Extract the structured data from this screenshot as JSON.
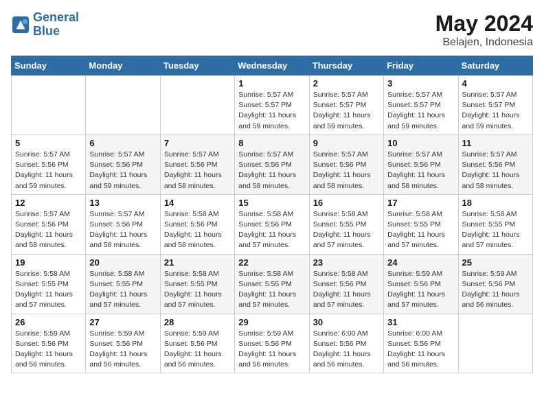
{
  "header": {
    "logo_line1": "General",
    "logo_line2": "Blue",
    "month": "May 2024",
    "location": "Belajen, Indonesia"
  },
  "weekdays": [
    "Sunday",
    "Monday",
    "Tuesday",
    "Wednesday",
    "Thursday",
    "Friday",
    "Saturday"
  ],
  "weeks": [
    [
      {
        "day": "",
        "info": ""
      },
      {
        "day": "",
        "info": ""
      },
      {
        "day": "",
        "info": ""
      },
      {
        "day": "1",
        "info": "Sunrise: 5:57 AM\nSunset: 5:57 PM\nDaylight: 11 hours\nand 59 minutes."
      },
      {
        "day": "2",
        "info": "Sunrise: 5:57 AM\nSunset: 5:57 PM\nDaylight: 11 hours\nand 59 minutes."
      },
      {
        "day": "3",
        "info": "Sunrise: 5:57 AM\nSunset: 5:57 PM\nDaylight: 11 hours\nand 59 minutes."
      },
      {
        "day": "4",
        "info": "Sunrise: 5:57 AM\nSunset: 5:57 PM\nDaylight: 11 hours\nand 59 minutes."
      }
    ],
    [
      {
        "day": "5",
        "info": "Sunrise: 5:57 AM\nSunset: 5:56 PM\nDaylight: 11 hours\nand 59 minutes."
      },
      {
        "day": "6",
        "info": "Sunrise: 5:57 AM\nSunset: 5:56 PM\nDaylight: 11 hours\nand 59 minutes."
      },
      {
        "day": "7",
        "info": "Sunrise: 5:57 AM\nSunset: 5:56 PM\nDaylight: 11 hours\nand 58 minutes."
      },
      {
        "day": "8",
        "info": "Sunrise: 5:57 AM\nSunset: 5:56 PM\nDaylight: 11 hours\nand 58 minutes."
      },
      {
        "day": "9",
        "info": "Sunrise: 5:57 AM\nSunset: 5:56 PM\nDaylight: 11 hours\nand 58 minutes."
      },
      {
        "day": "10",
        "info": "Sunrise: 5:57 AM\nSunset: 5:56 PM\nDaylight: 11 hours\nand 58 minutes."
      },
      {
        "day": "11",
        "info": "Sunrise: 5:57 AM\nSunset: 5:56 PM\nDaylight: 11 hours\nand 58 minutes."
      }
    ],
    [
      {
        "day": "12",
        "info": "Sunrise: 5:57 AM\nSunset: 5:56 PM\nDaylight: 11 hours\nand 58 minutes."
      },
      {
        "day": "13",
        "info": "Sunrise: 5:57 AM\nSunset: 5:56 PM\nDaylight: 11 hours\nand 58 minutes."
      },
      {
        "day": "14",
        "info": "Sunrise: 5:58 AM\nSunset: 5:56 PM\nDaylight: 11 hours\nand 58 minutes."
      },
      {
        "day": "15",
        "info": "Sunrise: 5:58 AM\nSunset: 5:56 PM\nDaylight: 11 hours\nand 57 minutes."
      },
      {
        "day": "16",
        "info": "Sunrise: 5:58 AM\nSunset: 5:55 PM\nDaylight: 11 hours\nand 57 minutes."
      },
      {
        "day": "17",
        "info": "Sunrise: 5:58 AM\nSunset: 5:55 PM\nDaylight: 11 hours\nand 57 minutes."
      },
      {
        "day": "18",
        "info": "Sunrise: 5:58 AM\nSunset: 5:55 PM\nDaylight: 11 hours\nand 57 minutes."
      }
    ],
    [
      {
        "day": "19",
        "info": "Sunrise: 5:58 AM\nSunset: 5:55 PM\nDaylight: 11 hours\nand 57 minutes."
      },
      {
        "day": "20",
        "info": "Sunrise: 5:58 AM\nSunset: 5:55 PM\nDaylight: 11 hours\nand 57 minutes."
      },
      {
        "day": "21",
        "info": "Sunrise: 5:58 AM\nSunset: 5:55 PM\nDaylight: 11 hours\nand 57 minutes."
      },
      {
        "day": "22",
        "info": "Sunrise: 5:58 AM\nSunset: 5:55 PM\nDaylight: 11 hours\nand 57 minutes."
      },
      {
        "day": "23",
        "info": "Sunrise: 5:58 AM\nSunset: 5:56 PM\nDaylight: 11 hours\nand 57 minutes."
      },
      {
        "day": "24",
        "info": "Sunrise: 5:59 AM\nSunset: 5:56 PM\nDaylight: 11 hours\nand 57 minutes."
      },
      {
        "day": "25",
        "info": "Sunrise: 5:59 AM\nSunset: 5:56 PM\nDaylight: 11 hours\nand 56 minutes."
      }
    ],
    [
      {
        "day": "26",
        "info": "Sunrise: 5:59 AM\nSunset: 5:56 PM\nDaylight: 11 hours\nand 56 minutes."
      },
      {
        "day": "27",
        "info": "Sunrise: 5:59 AM\nSunset: 5:56 PM\nDaylight: 11 hours\nand 56 minutes."
      },
      {
        "day": "28",
        "info": "Sunrise: 5:59 AM\nSunset: 5:56 PM\nDaylight: 11 hours\nand 56 minutes."
      },
      {
        "day": "29",
        "info": "Sunrise: 5:59 AM\nSunset: 5:56 PM\nDaylight: 11 hours\nand 56 minutes."
      },
      {
        "day": "30",
        "info": "Sunrise: 6:00 AM\nSunset: 5:56 PM\nDaylight: 11 hours\nand 56 minutes."
      },
      {
        "day": "31",
        "info": "Sunrise: 6:00 AM\nSunset: 5:56 PM\nDaylight: 11 hours\nand 56 minutes."
      },
      {
        "day": "",
        "info": ""
      }
    ]
  ]
}
